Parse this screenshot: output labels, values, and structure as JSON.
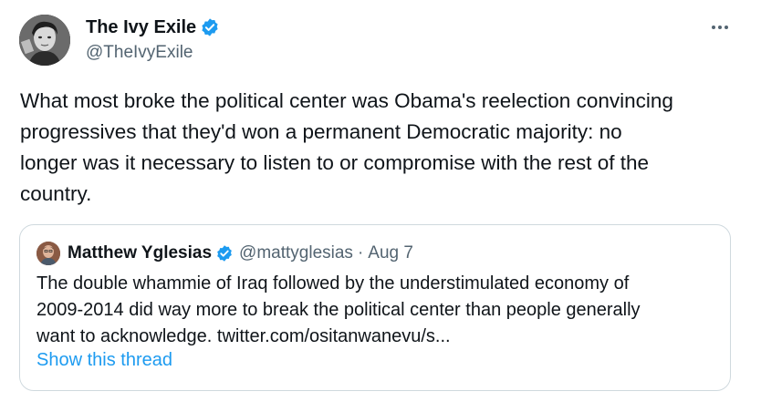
{
  "author": {
    "display_name": "The Ivy Exile",
    "handle": "@TheIvyExile",
    "verified_icon": "verified-badge-icon",
    "avatar_icon": "profile-photo"
  },
  "header": {
    "more_icon": "more-horizontal-icon"
  },
  "tweet": {
    "text": "What most broke the political center was Obama's reelection convincing\nprogressives that they'd won a permanent Democratic majority: no\nlonger was it necessary to listen to or compromise with the rest of the\ncountry."
  },
  "quote": {
    "display_name": "Matthew Yglesias",
    "handle": "@mattyglesias",
    "separator": "·",
    "date": "Aug 7",
    "text": "The double whammie of Iraq followed by the understimulated economy of\n2009-2014 did way more to break the political center than people generally\nwant to acknowledge. twitter.com/ositanwanevu/s...",
    "show_thread_label": "Show this thread"
  },
  "colors": {
    "verified": "#1d9bf0",
    "link": "#1d9bf0",
    "secondary_text": "#536471",
    "border": "#cfd9de"
  }
}
